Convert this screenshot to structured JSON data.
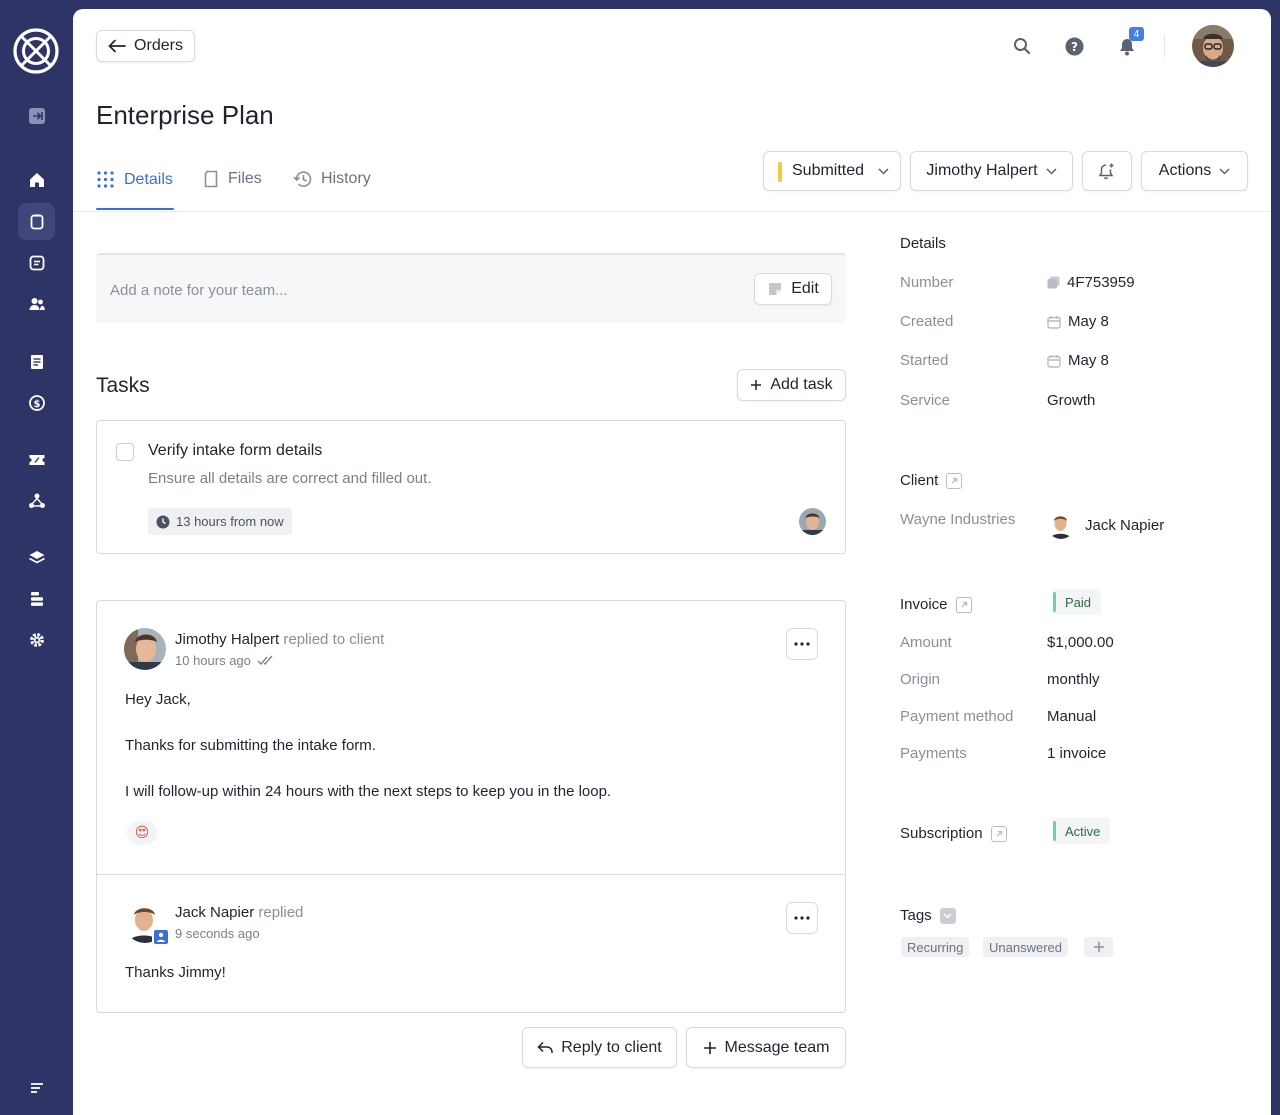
{
  "colors": {
    "sidebar": "#2e3466",
    "accent": "#3b6fd4",
    "submitted": "#f5c842",
    "paid": "#6fd39a"
  },
  "sidebar": {
    "items": [
      {
        "name": "collapse-icon"
      },
      {
        "name": "home-icon"
      },
      {
        "name": "orders-icon"
      },
      {
        "name": "messages-icon"
      },
      {
        "name": "clients-icon"
      },
      {
        "name": "invoices-icon"
      },
      {
        "name": "payments-icon"
      },
      {
        "name": "coupons-icon"
      },
      {
        "name": "affiliates-icon"
      },
      {
        "name": "services-icon"
      },
      {
        "name": "stack-icon"
      },
      {
        "name": "settings-icon"
      },
      {
        "name": "menu-icon"
      }
    ]
  },
  "header": {
    "back_label": "Orders",
    "notifications_count": "4",
    "title": "Enterprise Plan",
    "tabs": [
      {
        "label": "Details",
        "icon": "dots-grid-icon"
      },
      {
        "label": "Files",
        "icon": "file-icon"
      },
      {
        "label": "History",
        "icon": "history-icon"
      }
    ],
    "status": "Submitted",
    "assignee": "Jimothy Halpert",
    "actions_label": "Actions"
  },
  "note": {
    "placeholder": "Add a note for your team...",
    "edit_label": "Edit"
  },
  "tasks": {
    "title": "Tasks",
    "add_label": "Add task",
    "items": [
      {
        "title": "Verify intake form details",
        "description": "Ensure all details are correct and filled out.",
        "due": "13 hours from now"
      }
    ]
  },
  "messages": [
    {
      "author": "Jimothy Halpert",
      "action": "replied to client",
      "time": "10 hours ago",
      "lines": [
        "Hey Jack,",
        "Thanks for submitting the intake form.",
        "I will follow-up within 24 hours with the next steps to keep you in the loop."
      ],
      "reaction": "😍"
    },
    {
      "author": "Jack Napier",
      "action": "replied",
      "time": "9 seconds ago",
      "lines": [
        "Thanks Jimmy!"
      ]
    }
  ],
  "footer_actions": {
    "reply_label": "Reply to client",
    "message_label": "Message team"
  },
  "details": {
    "title": "Details",
    "number_label": "Number",
    "number": "4F753959",
    "created_label": "Created",
    "created": "May 8",
    "started_label": "Started",
    "started": "May 8",
    "service_label": "Service",
    "service": "Growth"
  },
  "client": {
    "title": "Client",
    "company": "Wayne Industries",
    "name": "Jack Napier"
  },
  "invoice": {
    "title": "Invoice",
    "status": "Paid",
    "amount_label": "Amount",
    "amount": "$1,000.00",
    "origin_label": "Origin",
    "origin": "monthly",
    "method_label": "Payment method",
    "method": "Manual",
    "payments_label": "Payments",
    "payments": "1 invoice"
  },
  "subscription": {
    "title": "Subscription",
    "status": "Active"
  },
  "tags": {
    "title": "Tags",
    "items": [
      "Recurring",
      "Unanswered"
    ]
  }
}
